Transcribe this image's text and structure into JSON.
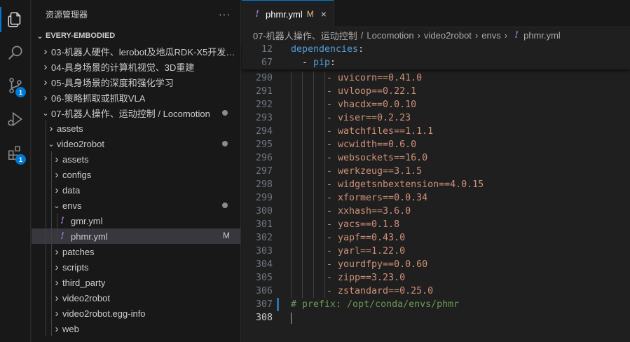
{
  "activity_bar": {
    "explorer_icon": "files-icon",
    "search_icon": "search-icon",
    "source_control_badge": "1",
    "run_debug_icon": "run-debug-icon",
    "extensions_badge": "1"
  },
  "sidebar": {
    "title": "资源管理器",
    "more": "···",
    "section": "EVERY-EMBODIED",
    "items": [
      {
        "label": "03-机器人硬件、lerobot及地瓜RDK-X5开发…",
        "expanded": false,
        "depth": 1
      },
      {
        "label": "04-具身场景的计算机视觉、3D重建",
        "expanded": false,
        "depth": 1
      },
      {
        "label": "05-具身场景的深度和强化学习",
        "expanded": false,
        "depth": 1
      },
      {
        "label": "06-策略抓取或抓取VLA",
        "expanded": false,
        "depth": 1
      },
      {
        "label": "07-机器人操作、运动控制 / Locomotion",
        "expanded": true,
        "depth": 1
      },
      {
        "label": "assets",
        "expanded": false,
        "depth": 2
      },
      {
        "label": "video2robot",
        "expanded": true,
        "depth": 2
      },
      {
        "label": "assets",
        "expanded": false,
        "depth": 3
      },
      {
        "label": "configs",
        "expanded": false,
        "depth": 3
      },
      {
        "label": "data",
        "expanded": false,
        "depth": 3
      },
      {
        "label": "envs",
        "expanded": true,
        "depth": 3
      },
      {
        "label": "gmr.yml",
        "depth": 4
      },
      {
        "label": "phmr.yml",
        "depth": 4,
        "status": "M"
      },
      {
        "label": "patches",
        "expanded": false,
        "depth": 3
      },
      {
        "label": "scripts",
        "expanded": false,
        "depth": 3
      },
      {
        "label": "third_party",
        "expanded": false,
        "depth": 3
      },
      {
        "label": "video2robot",
        "expanded": false,
        "depth": 3
      },
      {
        "label": "video2robot.egg-info",
        "expanded": false,
        "depth": 3
      },
      {
        "label": "web",
        "expanded": false,
        "depth": 3
      }
    ]
  },
  "editor": {
    "tab": {
      "label": "phmr.yml",
      "modified_flag": "M",
      "close": "×"
    },
    "breadcrumb": [
      "07-机器人操作、运动控制",
      "Locomotion",
      "video2robot",
      "envs",
      "phmr.yml"
    ],
    "sticky_lines": [
      {
        "n": "12",
        "key": "dependencies",
        "colon": ":"
      },
      {
        "n": "67",
        "dash": "- ",
        "key": "pip",
        "colon": ":"
      }
    ],
    "lines": [
      {
        "n": "290",
        "text": "- uvicorn==0.41.0"
      },
      {
        "n": "291",
        "text": "- uvloop==0.22.1"
      },
      {
        "n": "292",
        "text": "- vhacdx==0.0.10"
      },
      {
        "n": "293",
        "text": "- viser==0.2.23"
      },
      {
        "n": "294",
        "text": "- watchfiles==1.1.1"
      },
      {
        "n": "295",
        "text": "- wcwidth==0.6.0"
      },
      {
        "n": "296",
        "text": "- websockets==16.0"
      },
      {
        "n": "297",
        "text": "- werkzeug==3.1.5"
      },
      {
        "n": "298",
        "text": "- widgetsnbextension==4.0.15"
      },
      {
        "n": "299",
        "text": "- xformers==0.0.34"
      },
      {
        "n": "300",
        "text": "- xxhash==3.6.0"
      },
      {
        "n": "301",
        "text": "- yacs==0.1.8"
      },
      {
        "n": "302",
        "text": "- yapf==0.43.0"
      },
      {
        "n": "303",
        "text": "- yarl==1.22.0"
      },
      {
        "n": "304",
        "text": "- yourdfpy==0.0.60"
      },
      {
        "n": "305",
        "text": "- zipp==3.23.0"
      },
      {
        "n": "306",
        "text": "- zstandard==0.25.0"
      }
    ],
    "comment_line": {
      "n": "307",
      "text": "# prefix: /opt/conda/envs/phmr"
    },
    "last_line": {
      "n": "308",
      "text": ""
    }
  },
  "colors": {
    "accent": "#0078d4",
    "modified": "#e2c08d",
    "yaml_icon": "#a074c4",
    "string": "#ce9178",
    "key": "#569cd6",
    "comment": "#6a9955"
  }
}
